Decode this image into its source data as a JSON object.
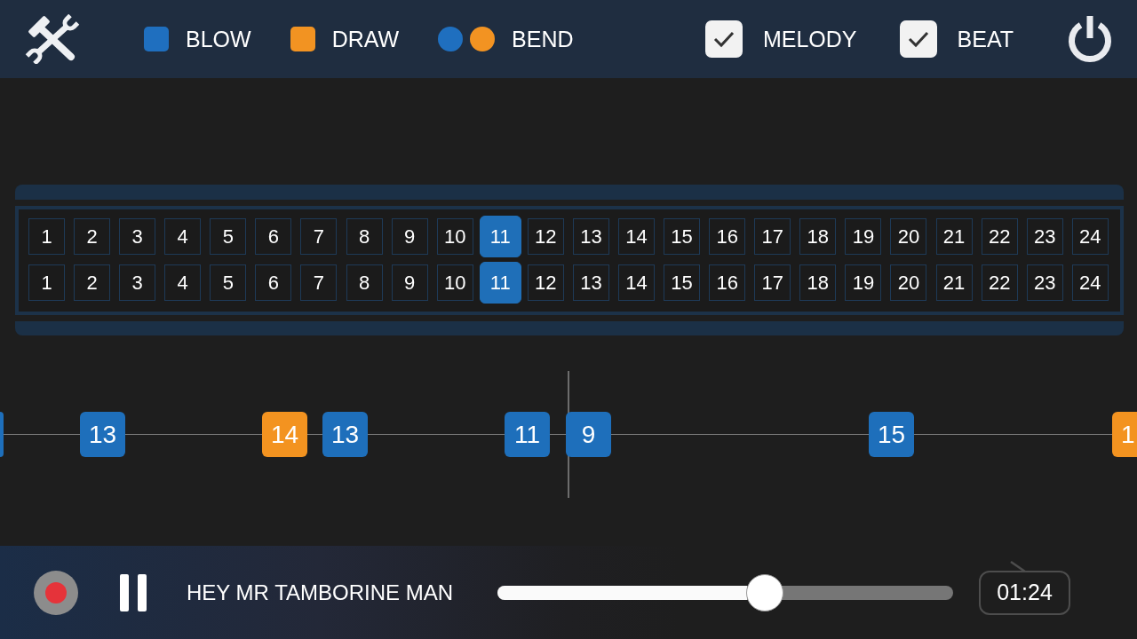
{
  "toolbar": {
    "legend": [
      {
        "kind": "square",
        "color": "#1f6fbf",
        "label": "BLOW"
      },
      {
        "kind": "square",
        "color": "#f29322",
        "label": "DRAW"
      },
      {
        "kind": "circles",
        "swatches": [
          {
            "color": "#1f6fbf"
          },
          {
            "color": "#f29322"
          }
        ],
        "label": "BEND"
      }
    ],
    "toggles": [
      {
        "label": "MELODY",
        "checked": true
      },
      {
        "label": "BEAT",
        "checked": true
      }
    ]
  },
  "harp": {
    "rows": [
      [
        {
          "label": "1",
          "selected": false
        },
        {
          "label": "2",
          "selected": false
        },
        {
          "label": "3",
          "selected": false
        },
        {
          "label": "4",
          "selected": false
        },
        {
          "label": "5",
          "selected": false
        },
        {
          "label": "6",
          "selected": false
        },
        {
          "label": "7",
          "selected": false
        },
        {
          "label": "8",
          "selected": false
        },
        {
          "label": "9",
          "selected": false
        },
        {
          "label": "10",
          "selected": false
        },
        {
          "label": "11",
          "selected": true
        },
        {
          "label": "12",
          "selected": false
        },
        {
          "label": "13",
          "selected": false
        },
        {
          "label": "14",
          "selected": false
        },
        {
          "label": "15",
          "selected": false
        },
        {
          "label": "16",
          "selected": false
        },
        {
          "label": "17",
          "selected": false
        },
        {
          "label": "18",
          "selected": false
        },
        {
          "label": "19",
          "selected": false
        },
        {
          "label": "20",
          "selected": false
        },
        {
          "label": "21",
          "selected": false
        },
        {
          "label": "22",
          "selected": false
        },
        {
          "label": "23",
          "selected": false
        },
        {
          "label": "24",
          "selected": false
        }
      ],
      [
        {
          "label": "1",
          "selected": false
        },
        {
          "label": "2",
          "selected": false
        },
        {
          "label": "3",
          "selected": false
        },
        {
          "label": "4",
          "selected": false
        },
        {
          "label": "5",
          "selected": false
        },
        {
          "label": "6",
          "selected": false
        },
        {
          "label": "7",
          "selected": false
        },
        {
          "label": "8",
          "selected": false
        },
        {
          "label": "9",
          "selected": false
        },
        {
          "label": "10",
          "selected": false
        },
        {
          "label": "11",
          "selected": true
        },
        {
          "label": "12",
          "selected": false
        },
        {
          "label": "13",
          "selected": false
        },
        {
          "label": "14",
          "selected": false
        },
        {
          "label": "15",
          "selected": false
        },
        {
          "label": "16",
          "selected": false
        },
        {
          "label": "17",
          "selected": false
        },
        {
          "label": "18",
          "selected": false
        },
        {
          "label": "19",
          "selected": false
        },
        {
          "label": "20",
          "selected": false
        },
        {
          "label": "21",
          "selected": false
        },
        {
          "label": "22",
          "selected": false
        },
        {
          "label": "23",
          "selected": false
        },
        {
          "label": "24",
          "selected": false
        }
      ]
    ]
  },
  "track": {
    "notes": [
      {
        "color": "#1e6fbb"
      },
      {
        "label": "13",
        "color": "#1e6fbb"
      },
      {
        "label": "14",
        "color": "#f39320"
      },
      {
        "label": "13",
        "color": "#1e6fbb"
      },
      {
        "label": "11",
        "color": "#1e6fbb"
      },
      {
        "label": "9",
        "color": "#1e6fbb"
      },
      {
        "label": "15",
        "color": "#1e6fbb"
      },
      {
        "label": "1",
        "color": "#f39320"
      }
    ]
  },
  "player": {
    "title": "HEY MR TAMBORINE MAN",
    "progress": {
      "level": 0.587
    },
    "time": "01:24"
  }
}
